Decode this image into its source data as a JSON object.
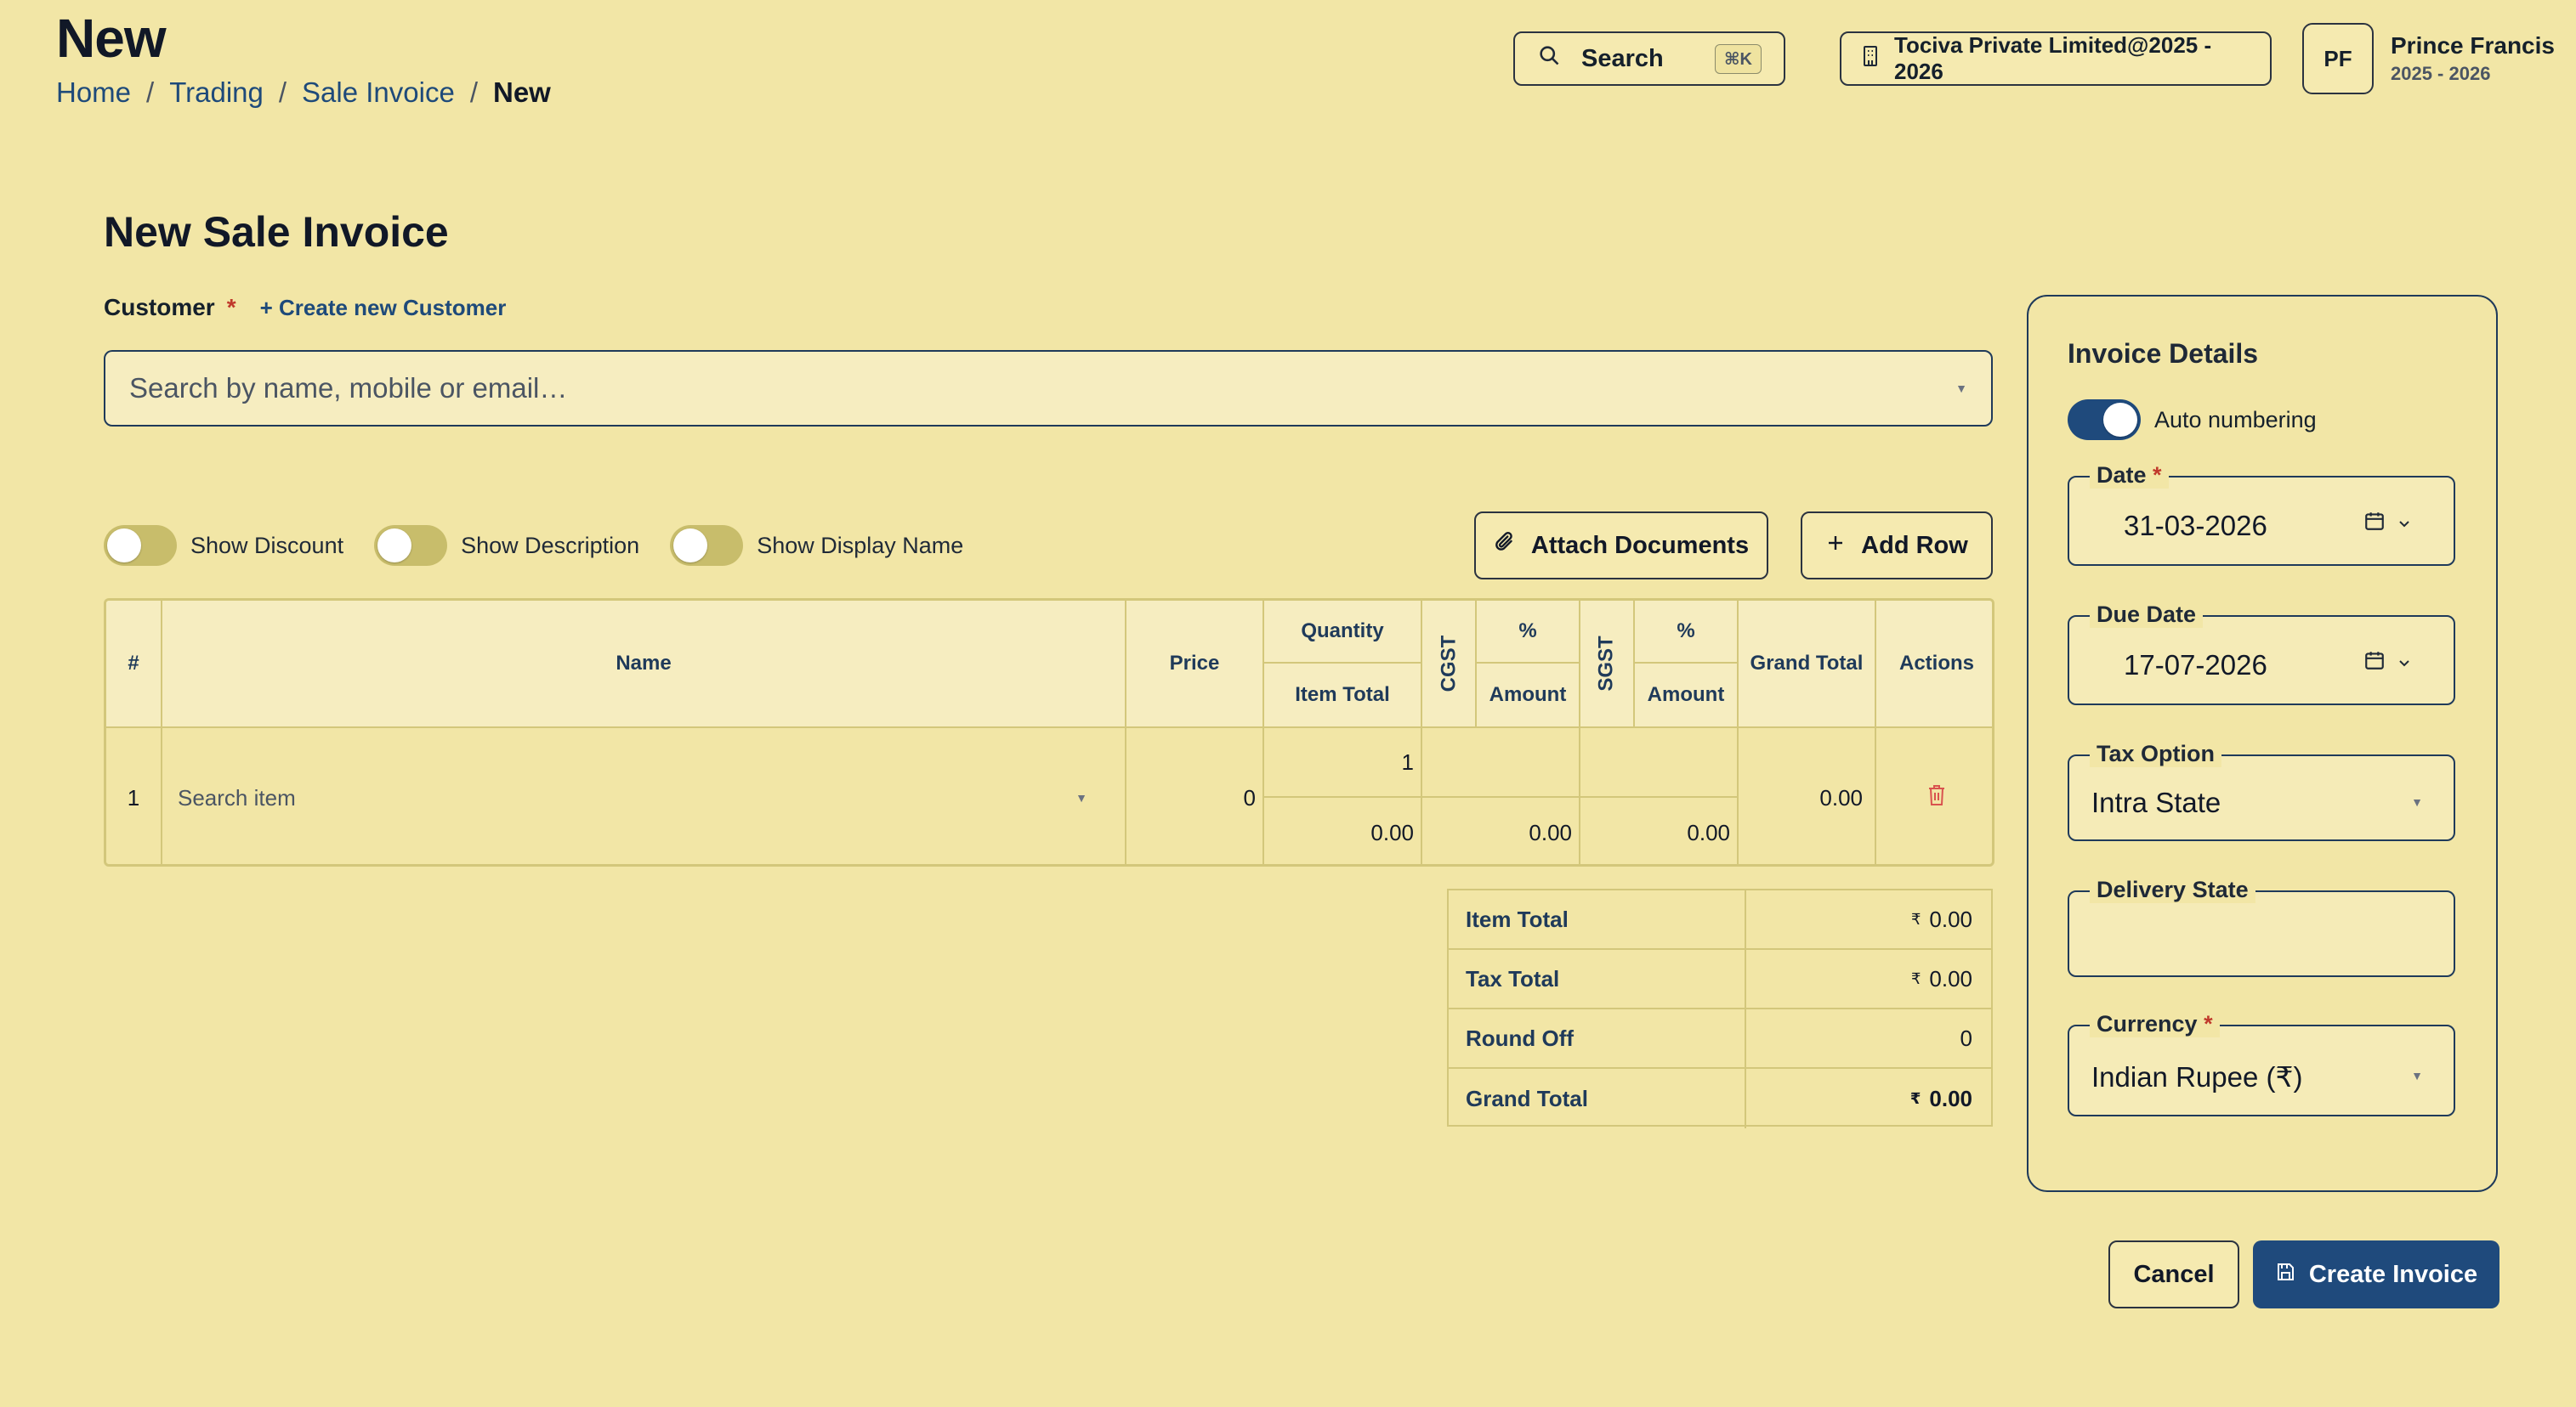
{
  "header": {
    "page_heading": "New",
    "breadcrumb": [
      "Home",
      "Trading",
      "Sale Invoice",
      "New"
    ],
    "search_label": "Search",
    "search_shortcut": "⌘K",
    "company": "Tociva Private Limited@2025 - 2026",
    "user": {
      "initials": "PF",
      "name": "Prince Francis",
      "year": "2025 - 2026"
    }
  },
  "form": {
    "title": "New Sale Invoice",
    "customer_label": "Customer",
    "required_mark": "*",
    "create_customer": "+ Create new Customer",
    "customer_placeholder": "Search by name, mobile or email…",
    "toggles": [
      {
        "label": "Show Discount",
        "on": false
      },
      {
        "label": "Show Description",
        "on": false
      },
      {
        "label": "Show Display Name",
        "on": false
      }
    ],
    "attach_label": "Attach Documents",
    "add_row_label": "Add Row"
  },
  "table": {
    "headers": {
      "index": "#",
      "name": "Name",
      "price": "Price",
      "quantity": "Quantity",
      "item_total": "Item Total",
      "cgst": "CGST",
      "cgst_pct": "%",
      "cgst_amount": "Amount",
      "sgst": "SGST",
      "sgst_pct": "%",
      "sgst_amount": "Amount",
      "grand_total": "Grand Total",
      "actions": "Actions"
    },
    "rows": [
      {
        "index": "1",
        "name_placeholder": "Search item",
        "price": "0",
        "quantity": "1",
        "item_total": "0.00",
        "cgst_amount": "0.00",
        "sgst_amount": "0.00",
        "grand_total": "0.00"
      }
    ]
  },
  "totals": {
    "currency_symbol": "₹",
    "rows": [
      {
        "label": "Item Total",
        "value": "0.00"
      },
      {
        "label": "Tax Total",
        "value": "0.00"
      },
      {
        "label": "Round Off",
        "value": "0"
      },
      {
        "label": "Grand Total",
        "value": "0.00"
      }
    ]
  },
  "invoice_details": {
    "title": "Invoice Details",
    "auto_numbering": "Auto numbering",
    "date_label": "Date",
    "date_value": "31-03-2026",
    "due_date_label": "Due Date",
    "due_date_value": "17-07-2026",
    "tax_option_label": "Tax Option",
    "tax_option_value": "Intra State",
    "delivery_state_label": "Delivery State",
    "delivery_state_value": "",
    "currency_label": "Currency",
    "currency_value": "Indian Rupee (₹)"
  },
  "actions": {
    "cancel": "Cancel",
    "create": "Create Invoice"
  },
  "colors": {
    "background": "#f2e6a6",
    "primary": "#1f4a7c",
    "required": "#c0392b",
    "danger": "#d9534f"
  }
}
